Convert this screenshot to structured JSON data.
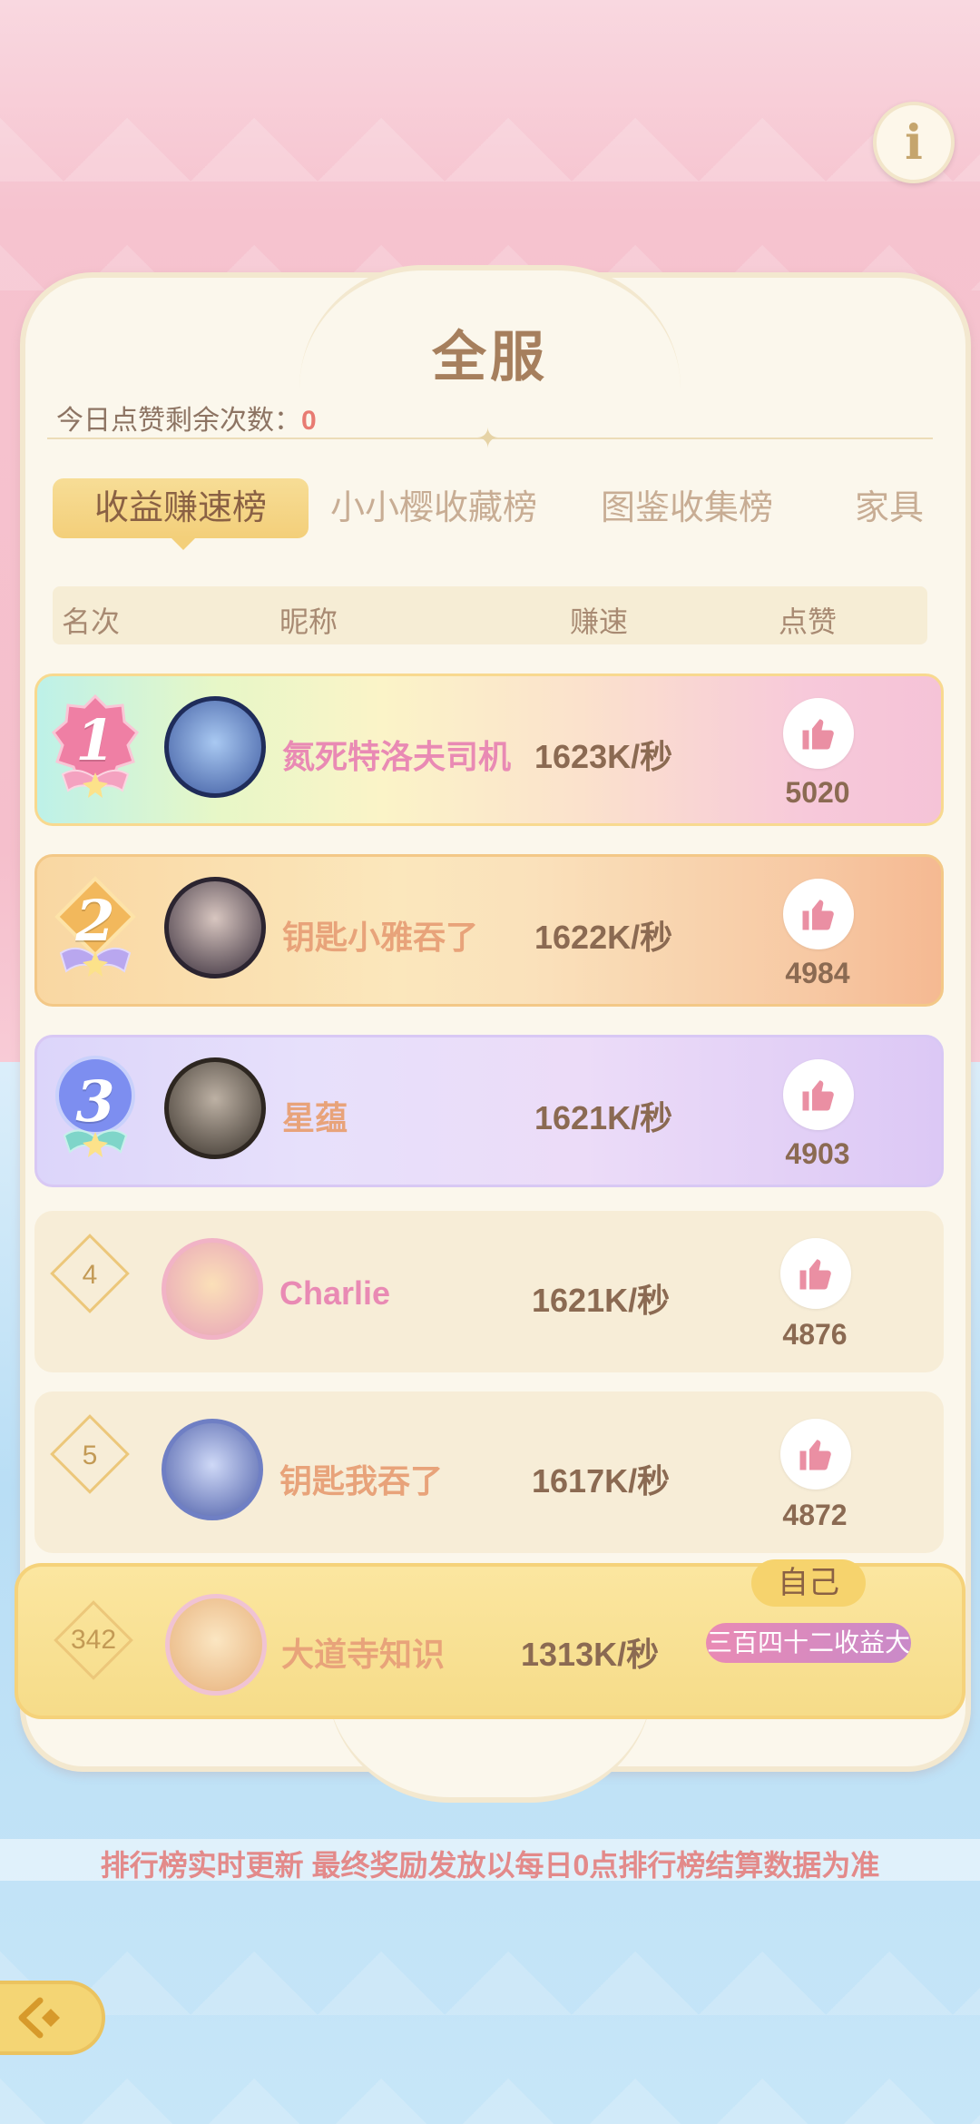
{
  "title": "全服",
  "likes_remaining": {
    "label": "今日点赞剩余次数：",
    "value": "0"
  },
  "tabs": [
    {
      "label": "收益赚速榜",
      "active": true
    },
    {
      "label": "小小樱收藏榜",
      "active": false
    },
    {
      "label": "图鉴收集榜",
      "active": false
    },
    {
      "label": "家具",
      "active": false
    }
  ],
  "columns": [
    "名次",
    "昵称",
    "赚速",
    "点赞"
  ],
  "rows": [
    {
      "rank": "1",
      "name": "氮死特洛夫司机",
      "speed": "1623K/秒",
      "likes": "5020",
      "name_color": "#e98ab4"
    },
    {
      "rank": "2",
      "name": "钥匙小雅吞了",
      "speed": "1622K/秒",
      "likes": "4984",
      "name_color": "#e8a37a"
    },
    {
      "rank": "3",
      "name": "星蕴",
      "speed": "1621K/秒",
      "likes": "4903",
      "name_color": "#e8a37a"
    },
    {
      "rank": "4",
      "name": "Charlie",
      "speed": "1621K/秒",
      "likes": "4876",
      "name_color": "#e98ab4"
    },
    {
      "rank": "5",
      "name": "钥匙我吞了",
      "speed": "1617K/秒",
      "likes": "4872",
      "name_color": "#e8a37a"
    }
  ],
  "self": {
    "rank": "342",
    "name": "大道寺知识",
    "speed": "1313K/秒",
    "tag": "自己",
    "title_badge": "三百四十二收益大"
  },
  "footer_notice": "排行榜实时更新 最终奖励发放以每日0点排行榜结算数据为准",
  "icons": {
    "info": "info-icon",
    "like": "thumbs-up-icon",
    "back": "back-arrow-icon"
  }
}
